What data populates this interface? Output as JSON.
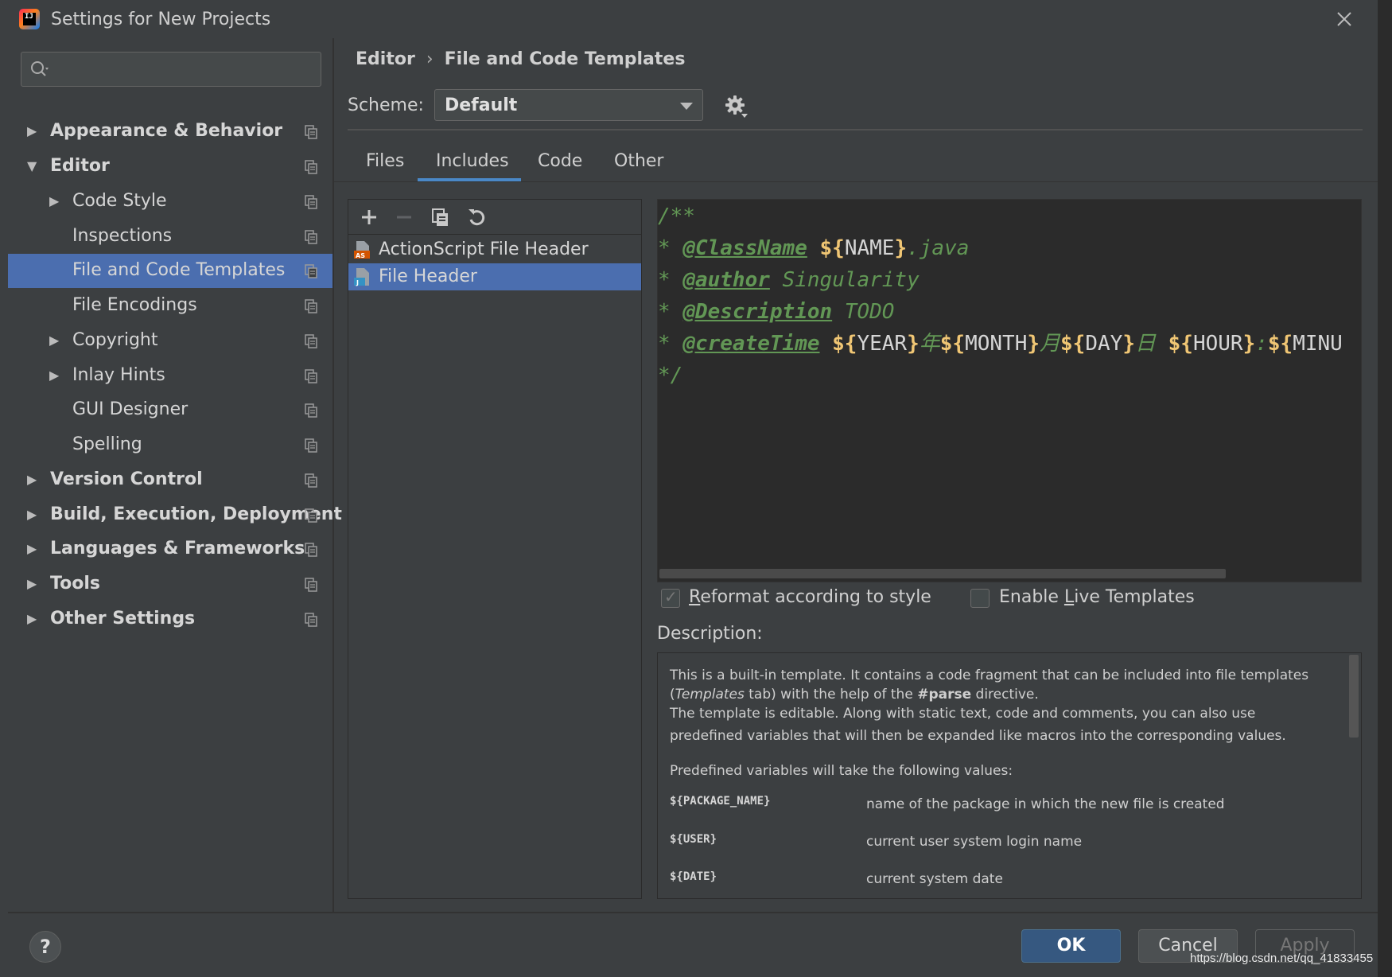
{
  "window": {
    "title": "Settings for New Projects",
    "app_icon": "intellij-idea-icon"
  },
  "search": {
    "placeholder": "",
    "value": ""
  },
  "tree": [
    {
      "label": "Appearance & Behavior",
      "bold": true,
      "expandable": true,
      "expanded": false
    },
    {
      "label": "Editor",
      "bold": true,
      "expandable": true,
      "expanded": true
    },
    {
      "label": "Code Style",
      "bold": false,
      "expandable": true,
      "expanded": false
    },
    {
      "label": "Inspections",
      "bold": false,
      "expandable": false
    },
    {
      "label": "File and Code Templates",
      "bold": false,
      "expandable": false,
      "selected": true
    },
    {
      "label": "File Encodings",
      "bold": false,
      "expandable": false
    },
    {
      "label": "Copyright",
      "bold": false,
      "expandable": true,
      "expanded": false
    },
    {
      "label": "Inlay Hints",
      "bold": false,
      "expandable": true,
      "expanded": false
    },
    {
      "label": "GUI Designer",
      "bold": false,
      "expandable": false
    },
    {
      "label": "Spelling",
      "bold": false,
      "expandable": false
    },
    {
      "label": "Version Control",
      "bold": true,
      "expandable": true,
      "expanded": false
    },
    {
      "label": "Build, Execution, Deployment",
      "bold": true,
      "expandable": true,
      "expanded": false
    },
    {
      "label": "Languages & Frameworks",
      "bold": true,
      "expandable": true,
      "expanded": false
    },
    {
      "label": "Tools",
      "bold": true,
      "expandable": true,
      "expanded": false
    },
    {
      "label": "Other Settings",
      "bold": true,
      "expandable": true,
      "expanded": false
    }
  ],
  "breadcrumb": {
    "parent": "Editor",
    "current": "File and Code Templates"
  },
  "scheme": {
    "label": "Scheme:",
    "value": "Default"
  },
  "tabs": [
    {
      "label": "Files"
    },
    {
      "label": "Includes",
      "active": true
    },
    {
      "label": "Code"
    },
    {
      "label": "Other"
    }
  ],
  "templates": [
    {
      "name": "ActionScript File Header",
      "icon": "actionscript-file-icon"
    },
    {
      "name": "File Header",
      "icon": "java-file-icon",
      "selected": true
    }
  ],
  "editor": {
    "line1": "/**",
    "line2_prefix": " * ",
    "line2_tag": "@ClassName",
    "line2_var_open": "${",
    "line2_var": "NAME",
    "line2_var_close": "}",
    "line2_suffix": ".java",
    "line3_prefix": " * ",
    "line3_tag": "@author",
    "line3_text": " Singularity",
    "line4_prefix": " * ",
    "line4_tag": "@Description",
    "line4_text": " TODO",
    "line5_prefix": " * ",
    "line5_tag": "@createTime",
    "line5_v1": "YEAR",
    "line5_s1": "年",
    "line5_v2": "MONTH",
    "line5_s2": "月",
    "line5_v3": "DAY",
    "line5_s3": "日 ",
    "line5_v4": "HOUR",
    "line5_s4": ":",
    "line5_v5": "MINU",
    "line6": " */",
    "brace_open": "${",
    "brace_close": "}"
  },
  "options": {
    "reformat_label_m": "R",
    "reformat_label_rest": "eformat according to style",
    "reformat_checked": true,
    "live_label_a": "Enable ",
    "live_label_m": "L",
    "live_label_b": "ive Templates",
    "live_checked": false
  },
  "description": {
    "label": "Description:",
    "line1": "This is a built-in template. It contains a code fragment that can be included into file templates",
    "line2_a": "(",
    "line2_italic": "Templates",
    "line2_b": " tab) with the help of the ",
    "line2_bold": "#parse",
    "line2_c": " directive.",
    "line3": "The template is editable. Along with static text, code and comments, you can also use",
    "line4": "predefined variables that will then be expanded like macros into the corresponding values.",
    "line5": "Predefined variables will take the following values:",
    "vars": [
      {
        "name": "${PACKAGE_NAME}",
        "desc": "name of the package in which the new file is created"
      },
      {
        "name": "${USER}",
        "desc": "current user system login name"
      },
      {
        "name": "${DATE}",
        "desc": "current system date"
      }
    ]
  },
  "buttons": {
    "help": "?",
    "ok": "OK",
    "cancel": "Cancel",
    "apply": "Apply"
  },
  "watermark": "https://blog.csdn.net/qq_41833455",
  "colors": {
    "selection": "#4b6eaf",
    "ok_button": "#365880",
    "comment_green": "#629755",
    "editor_bg": "#2b2b2b"
  }
}
